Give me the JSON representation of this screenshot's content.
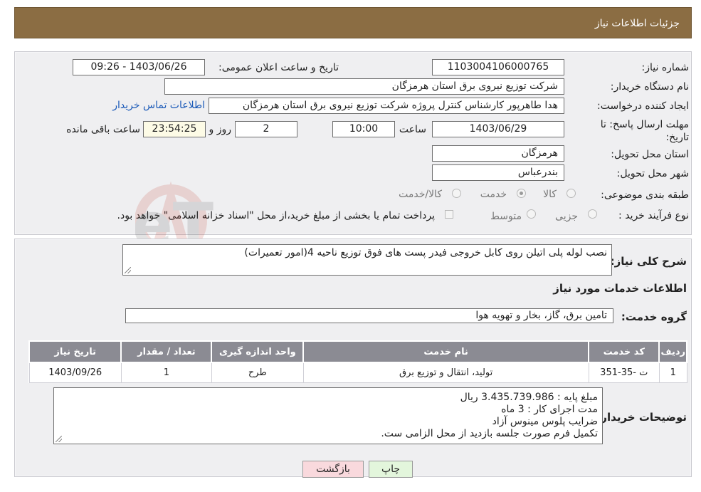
{
  "page": {
    "title": "جزئیات اطلاعات نیاز"
  },
  "form": {
    "need_number_label": "شماره نیاز:",
    "need_number": "1103004106000765",
    "announce_label": "تاریخ و ساعت اعلان عمومی:",
    "announce_value": "1403/06/26 - 09:26",
    "buyer_label": "نام دستگاه خریدار:",
    "buyer_value": "شرکت توزیع نیروی برق استان هرمزگان",
    "creator_label": "ایجاد کننده درخواست:",
    "creator_value": "هدا طاهرپور کارشناس کنترل پروژه شرکت توزیع نیروی برق استان هرمزگان",
    "contact_link": "اطلاعات تماس خریدار",
    "deadline_label": "مهلت ارسال پاسخ: تا تاریخ:",
    "deadline_date": "1403/06/29",
    "time_label": "ساعت",
    "deadline_time": "10:00",
    "days_value": "2",
    "days_label": "روز و",
    "remaining_time": "23:54:25",
    "remaining_label": "ساعت باقی مانده",
    "province_label": "استان محل تحویل:",
    "province_value": "هرمزگان",
    "city_label": "شهر محل تحویل:",
    "city_value": "بندرعباس",
    "category_label": "طبقه بندی موضوعی:",
    "category_options": [
      "کالا",
      "خدمت",
      "کالا/خدمت"
    ],
    "category_selected": "خدمت",
    "process_label": "نوع فرآیند خرید :",
    "process_options": [
      "جزیی",
      "متوسط"
    ],
    "process_selected": "",
    "payment_note": "پرداخت تمام یا بخشی از مبلغ خرید،از محل \"اسناد خزانه اسلامی\" خواهد بود."
  },
  "description": {
    "label": "شرح کلی نیاز:",
    "value": "نصب لوله پلی اتیلن روی کابل خروجی فیدر پست های فوق توزیع ناحیه 4(امور تعمیرات)"
  },
  "services": {
    "section_title": "اطلاعات خدمات مورد نیاز",
    "group_label": "گروه خدمت:",
    "group_value": "تامین برق، گاز، بخار و تهویه هوا",
    "table": {
      "headers": [
        "ردیف",
        "کد خدمت",
        "نام خدمت",
        "واحد اندازه گیری",
        "تعداد / مقدار",
        "تاریخ نیاز"
      ],
      "rows": [
        [
          "1",
          "ت -35-351",
          "تولید، انتقال و توزیع برق",
          "طرح",
          "1",
          "1403/09/26"
        ]
      ]
    }
  },
  "buyer_notes": {
    "label": "توضیحات خریدار:",
    "lines": [
      "مبلغ پایه : 3.435.739.986 ریال",
      "مدت اجرای کار : 3 ماه",
      "ضرایب پلوس مینوس آزاد",
      "تکمیل فرم صورت جلسه بازدید از محل الزامی ست."
    ]
  },
  "buttons": {
    "print": "چاپ",
    "back": "بازگشت"
  },
  "colors": {
    "title_bar": "#8b6d43",
    "panel": "#efeff1",
    "table_header": "#8b8b93",
    "back_button": "#f9d9dd",
    "print_button": "#e3f6dc"
  }
}
